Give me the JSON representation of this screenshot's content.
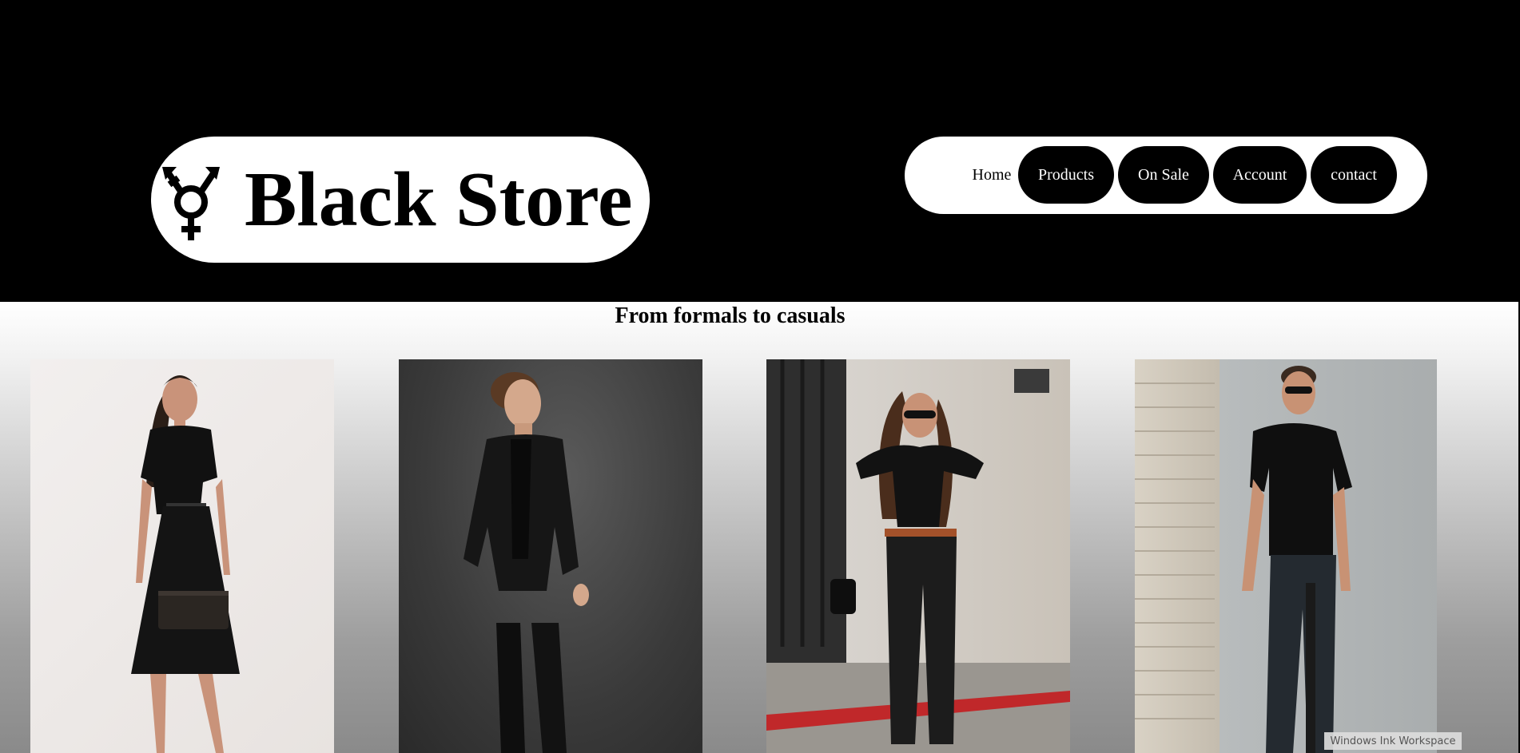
{
  "brand": {
    "name": "Black Store",
    "logo_icon": "transgender-symbol-icon"
  },
  "nav": {
    "items": [
      {
        "label": "Home",
        "style": "plain"
      },
      {
        "label": "Products",
        "style": "filled"
      },
      {
        "label": "On Sale",
        "style": "filled"
      },
      {
        "label": "Account",
        "style": "filled"
      },
      {
        "label": "contact",
        "style": "filled"
      }
    ]
  },
  "tagline": "From formals to casuals",
  "gallery": [
    {
      "subject": "woman-black-dress-photo"
    },
    {
      "subject": "man-black-suit-photo"
    },
    {
      "subject": "woman-black-casual-photo"
    },
    {
      "subject": "man-black-tshirt-photo"
    }
  ],
  "taskbar": {
    "ink_workspace_label": "Windows Ink Workspace"
  },
  "colors": {
    "header_bg": "#000000",
    "pill_bg": "#ffffff",
    "accent": "#000000"
  }
}
